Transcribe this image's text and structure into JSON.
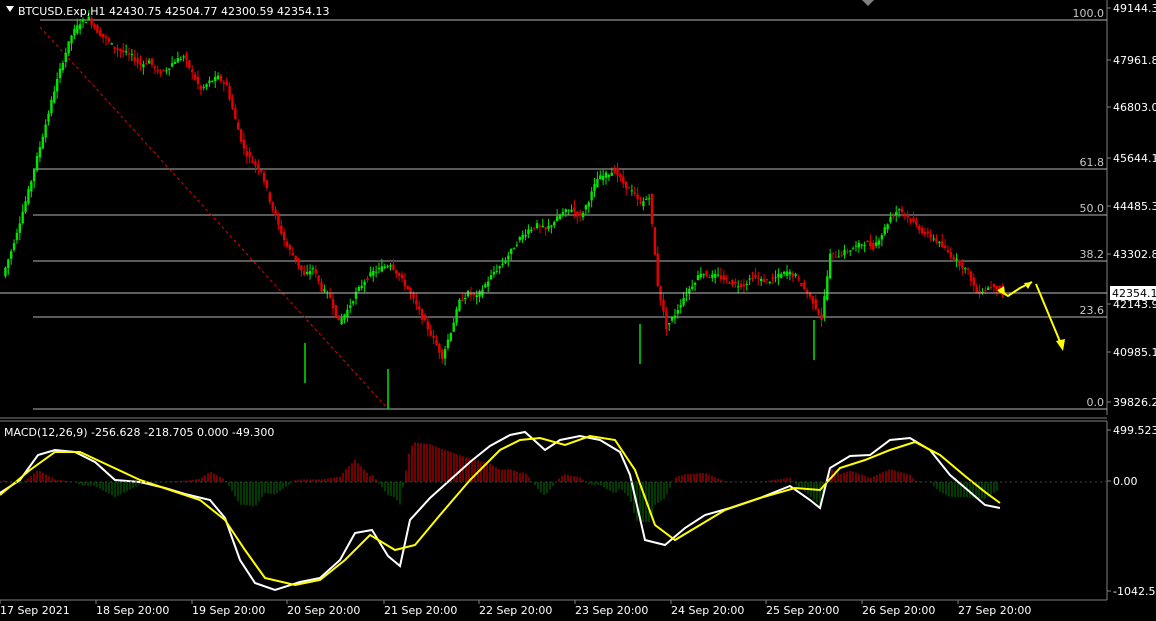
{
  "header": {
    "symbol_info": "BTCUSD.Exp,H1  42430.75 42504.77 42300.59 42354.13"
  },
  "macd_header": "MACD(12,26,9) -256.628 -218.705 0.000 -49.300",
  "colors": {
    "background": "#000000",
    "bull_candle": "#00e600",
    "bear_candle": "#e60000",
    "fib_line": "#c0c0c0",
    "trend_line": "#e60000",
    "macd_main": "#ffffff",
    "macd_signal": "#ffff00",
    "hist_pos": "#c00000",
    "hist_neg": "#006400",
    "forecast_arrow": "#ffff00"
  },
  "price_axis": [
    "49144.3",
    "47961.8",
    "46803.0",
    "45644.1",
    "44485.3",
    "43302.8",
    "42143.9",
    "40985.1",
    "39826.2"
  ],
  "current_price_label": "42354.1",
  "fib_levels": [
    {
      "label": "100.0"
    },
    {
      "label": "61.8"
    },
    {
      "label": "50.0"
    },
    {
      "label": "38.2"
    },
    {
      "label": "23.6"
    },
    {
      "label": "0.0"
    }
  ],
  "macd_axis": [
    "499.523",
    "0.00",
    "-1042.55"
  ],
  "time_axis": [
    "17 Sep 2021",
    "18 Sep 20:00",
    "19 Sep 20:00",
    "20 Sep 20:00",
    "21 Sep 20:00",
    "22 Sep 20:00",
    "23 Sep 20:00",
    "24 Sep 20:00",
    "25 Sep 20:00",
    "26 Sep 20:00",
    "27 Sep 20:00"
  ],
  "chart_data": {
    "type": "line",
    "series": [
      {
        "values": [
          42800,
          43400,
          44100,
          44800,
          45600,
          46400,
          47200,
          47900,
          48500,
          48800,
          48900,
          48600,
          48400,
          48200,
          48100,
          48000,
          47800,
          47900,
          47600,
          47700,
          47900,
          48000,
          47600,
          47200,
          47400,
          47500,
          47300,
          46500,
          45800,
          45500,
          45300,
          44600,
          44000,
          43500,
          43200,
          42800,
          43000,
          42500,
          42300,
          41700,
          42000,
          42400,
          42700,
          42900,
          43000,
          43100,
          42800,
          42500,
          42100,
          41700,
          41300,
          40900,
          41500,
          42200,
          42400,
          42300,
          42600,
          42900,
          43100,
          43400,
          43700,
          43900,
          44000,
          43900,
          44100,
          44300,
          44400,
          44200,
          44600,
          45100,
          45200,
          45300,
          45000,
          44800,
          44500,
          44700,
          42600,
          41600,
          41900,
          42300,
          42600,
          42900,
          42800,
          42800,
          42700,
          42600,
          42600,
          42800,
          42700,
          42700,
          42800,
          42900,
          42800,
          42500,
          42200,
          41800,
          43300,
          43300,
          43400,
          43500,
          43600,
          43500,
          43800,
          44200,
          44400,
          44200,
          44000,
          43800,
          43700,
          43500,
          43300,
          43100,
          42900,
          42400,
          42500,
          42600,
          42354
        ]
      }
    ]
  }
}
